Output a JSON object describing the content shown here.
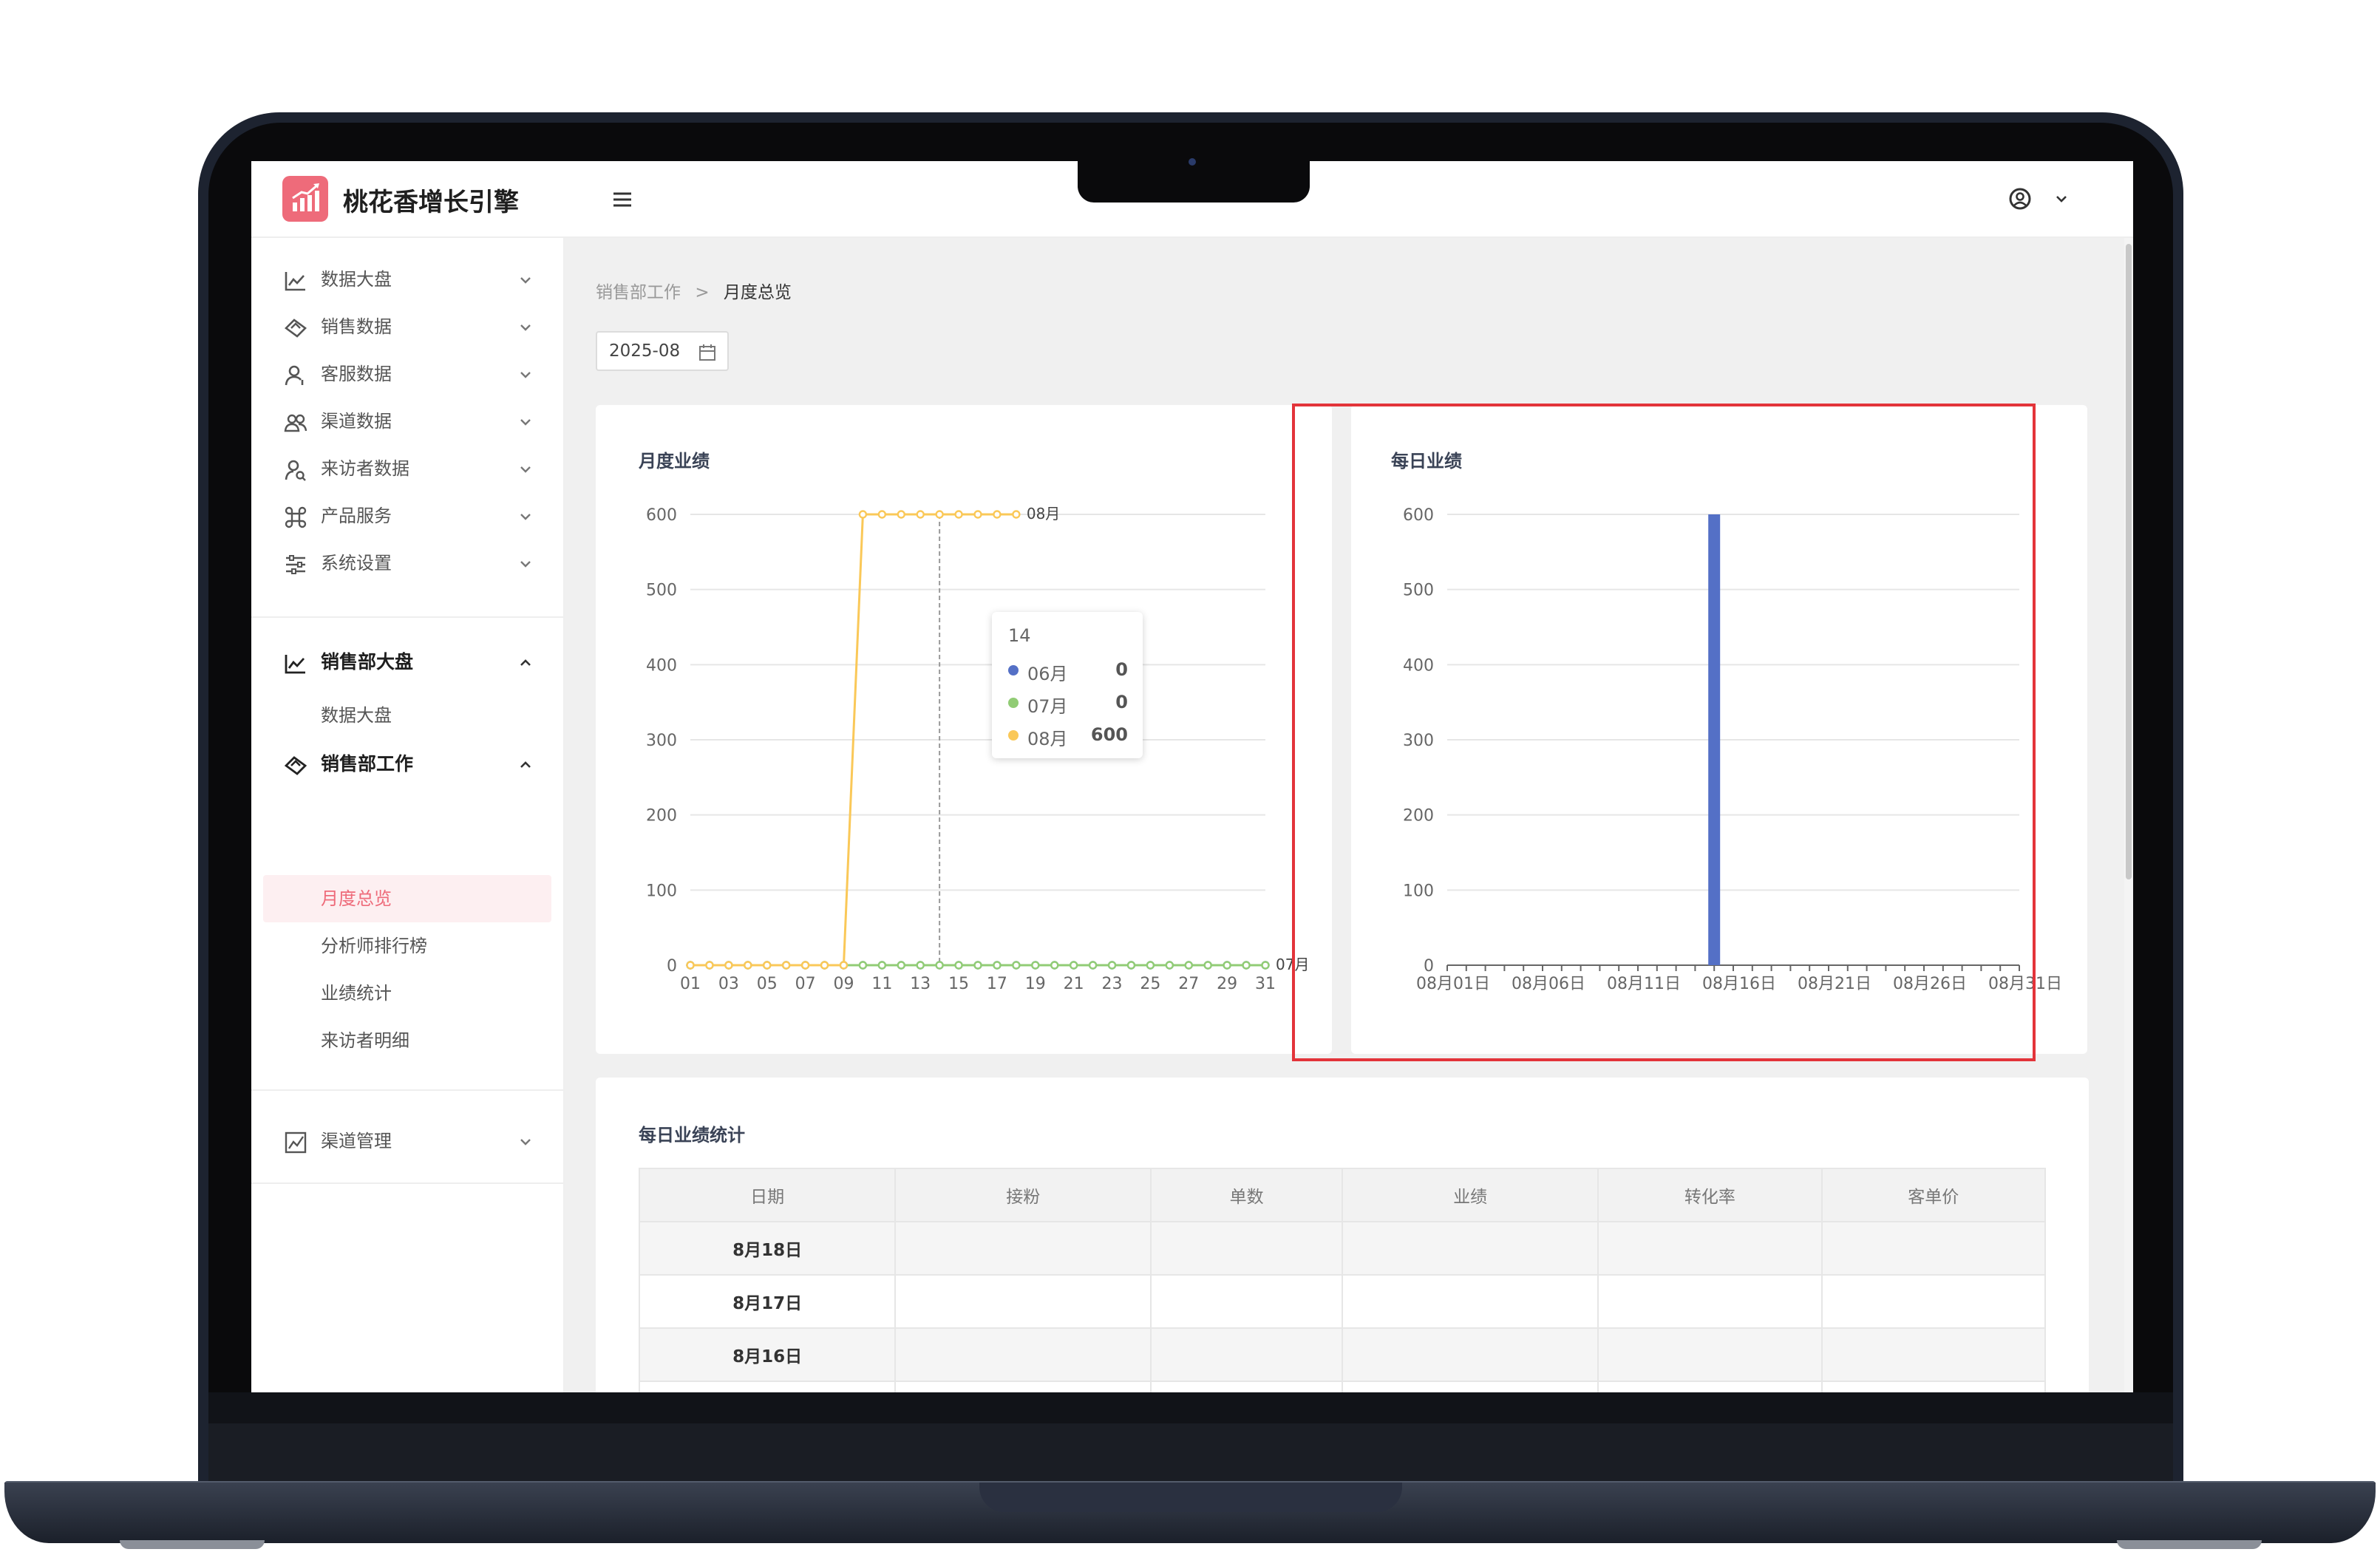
{
  "app": {
    "title": "桃花香增长引擎"
  },
  "sidebar": {
    "items": [
      {
        "label": "数据大盘",
        "icon": "line-chart-icon"
      },
      {
        "label": "销售数据",
        "icon": "handshake-icon"
      },
      {
        "label": "客服数据",
        "icon": "user-service-icon"
      },
      {
        "label": "渠道数据",
        "icon": "team-icon"
      },
      {
        "label": "来访者数据",
        "icon": "user-search-icon"
      },
      {
        "label": "产品服务",
        "icon": "command-icon"
      },
      {
        "label": "系统设置",
        "icon": "sliders-icon"
      }
    ],
    "group1": {
      "label": "销售部大盘",
      "sub": [
        "数据大盘"
      ]
    },
    "group2": {
      "label": "销售部工作",
      "sub": [
        "月度总览",
        "分析师排行榜",
        "业绩统计",
        "来访者明细"
      ]
    },
    "group3": {
      "label": "渠道管理"
    }
  },
  "breadcrumb": {
    "parent": "销售部工作",
    "separator": ">",
    "current": "月度总览"
  },
  "date_picker": {
    "value": "2025-08"
  },
  "charts": {
    "monthly_title": "月度业绩",
    "daily_title": "每日业绩"
  },
  "tooltip": {
    "title": "14",
    "rows": [
      {
        "name": "06月",
        "value": "0"
      },
      {
        "name": "07月",
        "value": "0"
      },
      {
        "name": "08月",
        "value": "600"
      }
    ]
  },
  "colors": {
    "accent": "#ee6b7a",
    "series_06": "#5470c6",
    "series_07": "#91cc75",
    "series_08": "#fac858",
    "highlight": "#e3343a"
  },
  "chart_data": [
    {
      "type": "line",
      "title": "月度业绩",
      "x": [
        "01",
        "02",
        "03",
        "04",
        "05",
        "06",
        "07",
        "08",
        "09",
        "10",
        "11",
        "12",
        "13",
        "14",
        "15",
        "16",
        "17",
        "18",
        "19",
        "20",
        "21",
        "22",
        "23",
        "24",
        "25",
        "26",
        "27",
        "28",
        "29",
        "30",
        "31"
      ],
      "xticks": [
        "01",
        "03",
        "05",
        "07",
        "09",
        "11",
        "13",
        "15",
        "17",
        "19",
        "21",
        "23",
        "25",
        "27",
        "29",
        "31"
      ],
      "ylim": [
        0,
        600
      ],
      "yticks": [
        0,
        100,
        200,
        300,
        400,
        500,
        600
      ],
      "series": [
        {
          "name": "06月",
          "values": [
            0,
            0,
            0,
            0,
            0,
            0,
            0,
            0,
            0,
            0,
            0,
            0,
            0,
            0,
            0,
            0,
            0,
            0,
            0,
            0,
            0,
            0,
            0,
            0,
            0,
            0,
            0,
            0,
            0,
            0,
            0
          ]
        },
        {
          "name": "07月",
          "values": [
            0,
            0,
            0,
            0,
            0,
            0,
            0,
            0,
            0,
            0,
            0,
            0,
            0,
            0,
            0,
            0,
            0,
            0,
            0,
            0,
            0,
            0,
            0,
            0,
            0,
            0,
            0,
            0,
            0,
            0,
            0
          ]
        },
        {
          "name": "08月",
          "values": [
            0,
            0,
            0,
            0,
            0,
            0,
            0,
            0,
            0,
            600,
            600,
            600,
            600,
            600,
            600,
            600,
            600,
            600
          ]
        }
      ],
      "end_labels": [
        "08月",
        "07月"
      ],
      "grid": true
    },
    {
      "type": "bar",
      "title": "每日业绩",
      "x": [
        "08月01日",
        "08月02日",
        "08月03日",
        "08月04日",
        "08月05日",
        "08月06日",
        "08月07日",
        "08月08日",
        "08月09日",
        "08月10日",
        "08月11日",
        "08月12日",
        "08月13日",
        "08月14日",
        "08月15日",
        "08月16日",
        "08月17日",
        "08月18日",
        "08月19日",
        "08月20日",
        "08月21日",
        "08月22日",
        "08月23日",
        "08月24日",
        "08月25日",
        "08月26日",
        "08月27日",
        "08月28日",
        "08月29日",
        "08月30日",
        "08月31日"
      ],
      "xticks": [
        "08月01日",
        "08月06日",
        "08月11日",
        "08月16日",
        "08月21日",
        "08月26日",
        "08月31日"
      ],
      "values": [
        0,
        0,
        0,
        0,
        0,
        0,
        0,
        0,
        0,
        0,
        0,
        0,
        0,
        0,
        600,
        0,
        0,
        0,
        0,
        0,
        0,
        0,
        0,
        0,
        0,
        0,
        0,
        0,
        0,
        0,
        0
      ],
      "ylim": [
        0,
        600
      ],
      "yticks": [
        0,
        100,
        200,
        300,
        400,
        500,
        600
      ],
      "grid": true
    }
  ],
  "table": {
    "title": "每日业绩统计",
    "headers": [
      "日期",
      "接粉",
      "单数",
      "业绩",
      "转化率",
      "客单价"
    ],
    "rows": [
      [
        "8月18日",
        "",
        "",
        "",
        "",
        ""
      ],
      [
        "8月17日",
        "",
        "",
        "",
        "",
        ""
      ],
      [
        "8月16日",
        "",
        "",
        "",
        "",
        ""
      ]
    ]
  }
}
